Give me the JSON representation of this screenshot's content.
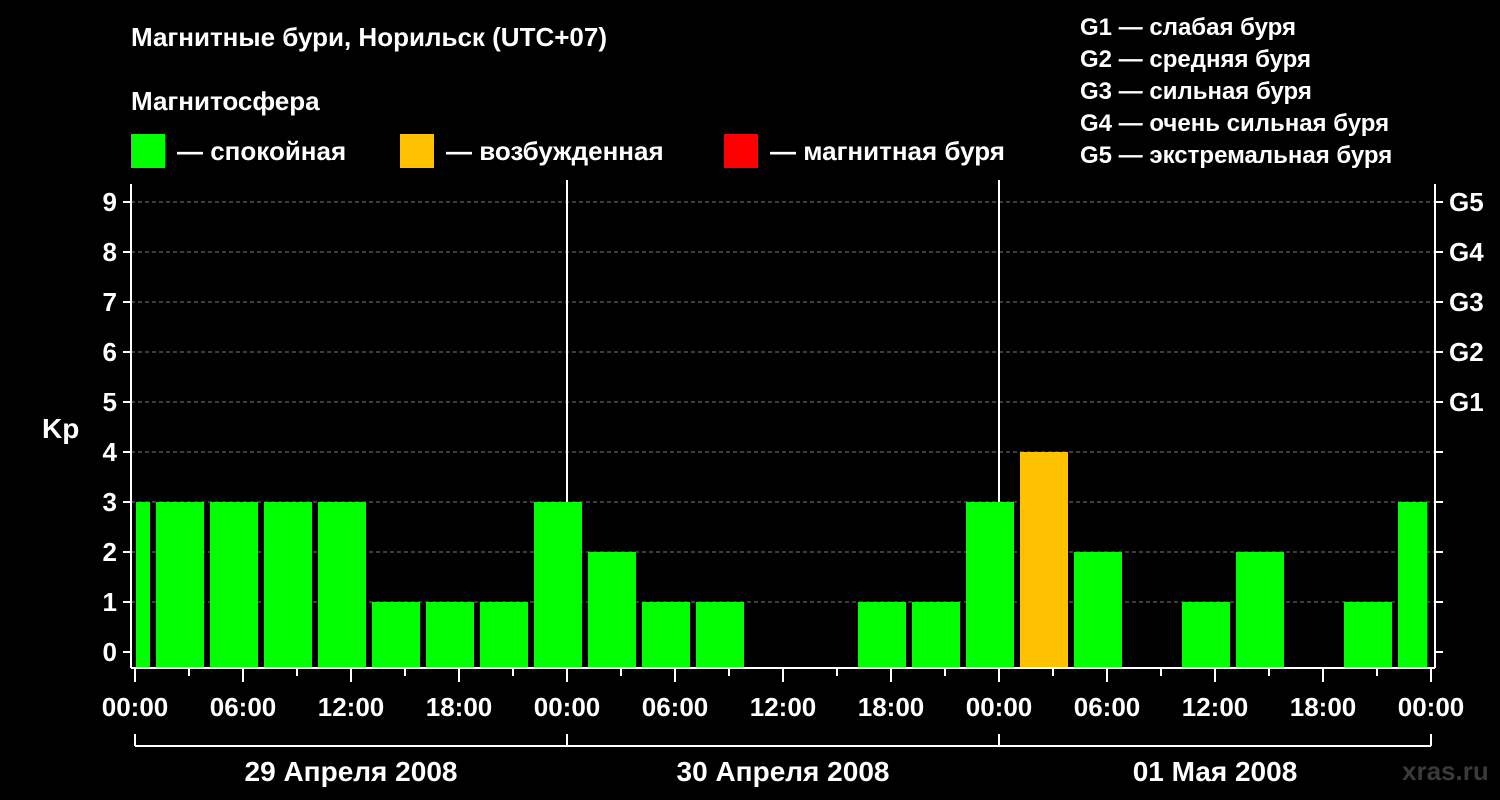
{
  "header": {
    "title": "Магнитные бури, Норильск (UTC+07)",
    "subtitle": "Магнитосфера"
  },
  "legend": {
    "items": [
      {
        "label": "— спокойная",
        "color": "#00ff00"
      },
      {
        "label": "— возбужденная",
        "color": "#ffc000"
      },
      {
        "label": "— магнитная буря",
        "color": "#ff0000"
      }
    ]
  },
  "storm_scale": [
    "G1 — слабая буря",
    "G2 — средняя буря",
    "G3 — сильная буря",
    "G4 — очень сильная буря",
    "G5 — экстремальная буря"
  ],
  "watermark": "xras.ru",
  "chart_data": {
    "type": "bar",
    "ylabel": "Kp",
    "ylim": [
      0,
      9
    ],
    "yticks": [
      0,
      1,
      2,
      3,
      4,
      5,
      6,
      7,
      8,
      9
    ],
    "right_ticks": [
      {
        "value": 5,
        "label": "G1"
      },
      {
        "value": 6,
        "label": "G2"
      },
      {
        "value": 7,
        "label": "G3"
      },
      {
        "value": 8,
        "label": "G4"
      },
      {
        "value": 9,
        "label": "G5"
      }
    ],
    "grid": true,
    "x_tick_labels": [
      "00:00",
      "06:00",
      "12:00",
      "18:00",
      "00:00",
      "06:00",
      "12:00",
      "18:00",
      "00:00",
      "06:00",
      "12:00",
      "18:00",
      "00:00"
    ],
    "days": [
      "29 Апреля 2008",
      "30 Апреля 2008",
      "01 Мая 2008"
    ],
    "colors": {
      "quiet": "#00ff00",
      "active": "#ffc000",
      "storm": "#ff0000"
    },
    "bars": [
      {
        "start": 0,
        "end": 1,
        "kp": 3,
        "level": "quiet"
      },
      {
        "start": 1,
        "end": 4,
        "kp": 3,
        "level": "quiet"
      },
      {
        "start": 4,
        "end": 7,
        "kp": 3,
        "level": "quiet"
      },
      {
        "start": 7,
        "end": 10,
        "kp": 3,
        "level": "quiet"
      },
      {
        "start": 10,
        "end": 13,
        "kp": 3,
        "level": "quiet"
      },
      {
        "start": 13,
        "end": 16,
        "kp": 1,
        "level": "quiet"
      },
      {
        "start": 16,
        "end": 19,
        "kp": 1,
        "level": "quiet"
      },
      {
        "start": 19,
        "end": 22,
        "kp": 1,
        "level": "quiet"
      },
      {
        "start": 22,
        "end": 25,
        "kp": 3,
        "level": "quiet"
      },
      {
        "start": 25,
        "end": 28,
        "kp": 2,
        "level": "quiet"
      },
      {
        "start": 28,
        "end": 31,
        "kp": 1,
        "level": "quiet"
      },
      {
        "start": 31,
        "end": 34,
        "kp": 1,
        "level": "quiet"
      },
      {
        "start": 34,
        "end": 37,
        "kp": 0,
        "level": "quiet"
      },
      {
        "start": 37,
        "end": 40,
        "kp": 0,
        "level": "quiet"
      },
      {
        "start": 40,
        "end": 43,
        "kp": 1,
        "level": "quiet"
      },
      {
        "start": 43,
        "end": 46,
        "kp": 1,
        "level": "quiet"
      },
      {
        "start": 46,
        "end": 49,
        "kp": 3,
        "level": "quiet"
      },
      {
        "start": 49,
        "end": 52,
        "kp": 4,
        "level": "active"
      },
      {
        "start": 52,
        "end": 55,
        "kp": 2,
        "level": "quiet"
      },
      {
        "start": 55,
        "end": 58,
        "kp": 0,
        "level": "quiet"
      },
      {
        "start": 58,
        "end": 61,
        "kp": 1,
        "level": "quiet"
      },
      {
        "start": 61,
        "end": 64,
        "kp": 2,
        "level": "quiet"
      },
      {
        "start": 64,
        "end": 67,
        "kp": 0,
        "level": "quiet"
      },
      {
        "start": 67,
        "end": 70,
        "kp": 1,
        "level": "quiet"
      },
      {
        "start": 70,
        "end": 72,
        "kp": 3,
        "level": "quiet"
      }
    ]
  }
}
